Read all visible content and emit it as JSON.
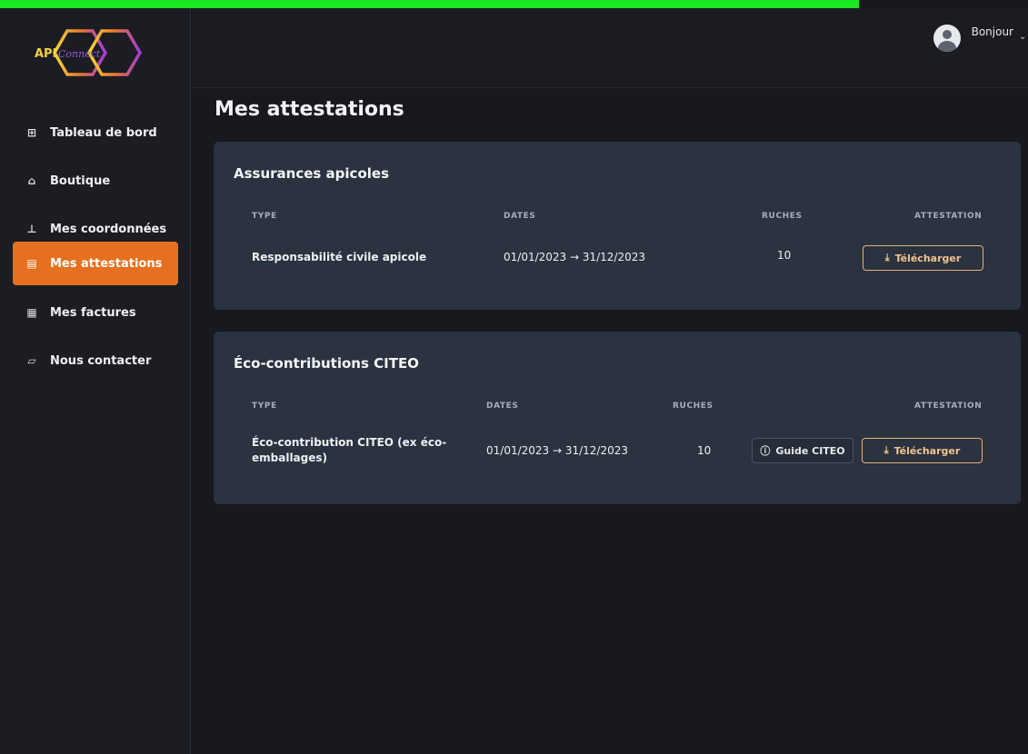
{
  "brand": {
    "api": "API",
    "connect": "Connect"
  },
  "sidebar": {
    "items": [
      {
        "label": "Tableau de bord",
        "icon": "⊞"
      },
      {
        "label": "Boutique",
        "icon": "⌂"
      },
      {
        "label": "Mes coordonnées",
        "icon": "⊥"
      },
      {
        "label": "Mes attestations",
        "icon": "▤",
        "active": true
      },
      {
        "label": "Mes factures",
        "icon": "▦"
      },
      {
        "label": "Nous contacter",
        "icon": "▱"
      }
    ]
  },
  "header": {
    "greeting": "Bonjour",
    "caret": "⌄"
  },
  "main": {
    "title": "Mes attestations",
    "sections": [
      {
        "title": "Assurances apicoles",
        "columns": [
          "TYPE",
          "DATES",
          "RUCHES",
          "ATTESTATION"
        ],
        "rows": [
          {
            "type": "Responsabilité civile apicole",
            "dates": "01/01/2023 → 31/12/2023",
            "ruches": "10",
            "download_label": "Télécharger"
          }
        ]
      },
      {
        "title": "Éco-contributions CITEO",
        "columns": [
          "TYPE",
          "DATES",
          "RUCHES",
          "ATTESTATION"
        ],
        "rows": [
          {
            "type_line1": "Éco-contribution CITEO (ex éco-",
            "type_line2": "emballages)",
            "dates": "01/01/2023 → 31/12/2023",
            "ruches": "10",
            "guide_label": "Guide CITEO",
            "download_label": "Télécharger"
          }
        ]
      }
    ]
  },
  "colors": {
    "accent": "#e5701f",
    "card": "#2b3240",
    "background": "#17191f",
    "button_outline": "#e2b27a"
  }
}
